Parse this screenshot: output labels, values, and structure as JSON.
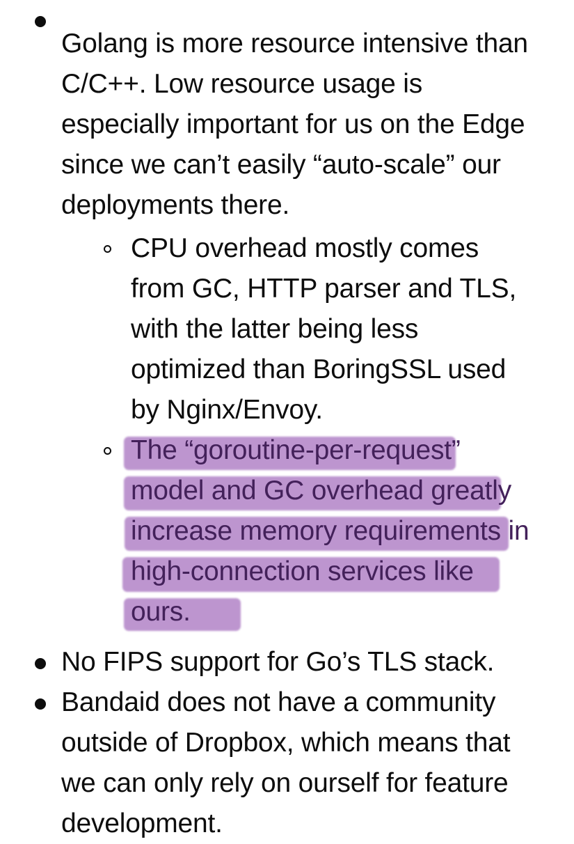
{
  "document": {
    "kind": "screenshot-of-bulleted-notes",
    "background_color": "#ffffff",
    "text_color": "#0d0d0d",
    "highlight_color": "#bb92ce",
    "highlight_text_color": "#43215a"
  },
  "markers": {
    "level_1": "•",
    "level_2": "○"
  },
  "bullets": [
    {
      "level": 1,
      "marker": "disc",
      "highlighted": false,
      "text": "Golang is more resource intensive than C/C++. Low resource usage is especially important for us on the Edge since we can’t easily “auto-scale” our deployments there.",
      "lines": [
        "Golang is more resource intensive than",
        "C/C++. Low resource usage is",
        "especially important for us on the Edge",
        "since we can’t easily “auto-scale” our",
        "deployments there."
      ],
      "children": [
        {
          "level": 2,
          "marker": "circle",
          "highlighted": false,
          "text": "CPU overhead mostly comes from GC, HTTP parser and TLS, with the latter being less optimized than BoringSSL used by Nginx/Envoy.",
          "lines": [
            "CPU overhead mostly comes",
            "from GC, HTTP parser and TLS,",
            "with the latter being less",
            "optimized than BoringSSL used",
            "by Nginx/Envoy."
          ]
        },
        {
          "level": 2,
          "marker": "circle",
          "highlighted": true,
          "text": "The “goroutine-per-request” model and GC overhead greatly increase memory requirements in high-connection services like ours.",
          "lines": [
            "The “goroutine-per-request”",
            "model and GC overhead greatly",
            "increase memory requirements",
            "in high-connection services like",
            "ours."
          ]
        }
      ]
    },
    {
      "level": 1,
      "marker": "disc",
      "highlighted": false,
      "text": "No FIPS support for Go’s TLS stack.",
      "lines": [
        "No FIPS support for Go’s TLS stack."
      ],
      "children": []
    },
    {
      "level": 1,
      "marker": "disc",
      "highlighted": false,
      "text": "Bandaid does not have a community outside of Dropbox, which means that we can only rely on ourself for feature development.",
      "lines": [
        "Bandaid does not have a community",
        "outside of Dropbox, which means that",
        "we can only rely on ourself for feature",
        "development."
      ],
      "children": []
    }
  ]
}
